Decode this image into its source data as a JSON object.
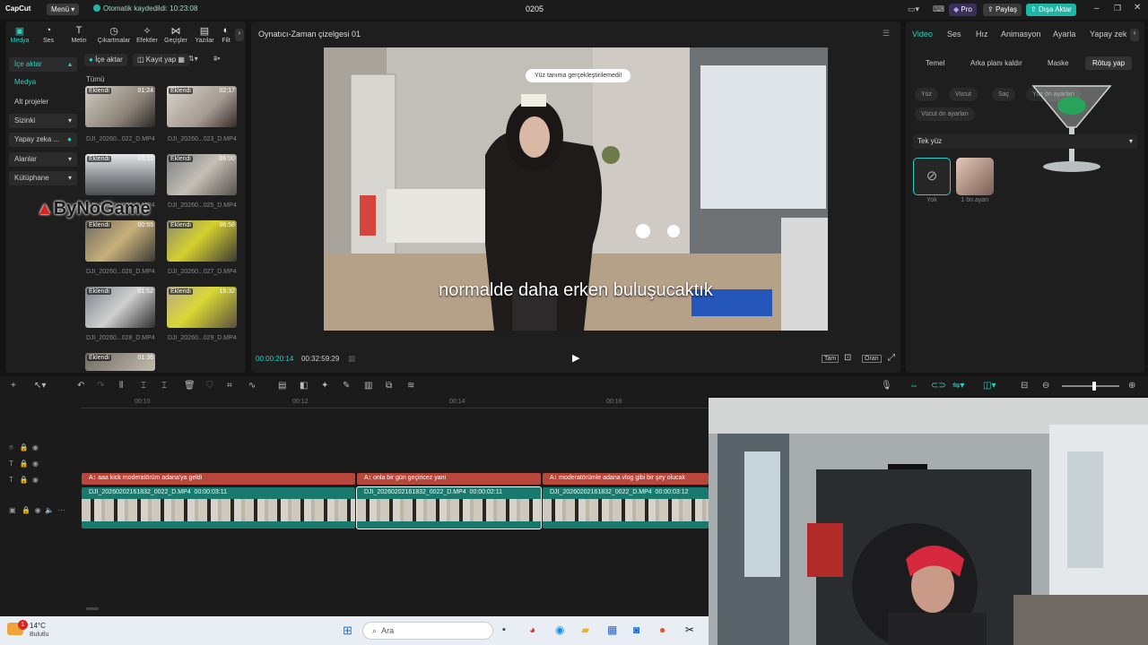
{
  "titlebar": {
    "app": "CapCut",
    "menu": "Menü",
    "autosave": "Otomatik kaydedildi: 10:23:08",
    "project": "0205",
    "pro": "Pro",
    "share": "Paylaş",
    "export": "Dışa Aktar"
  },
  "toolbar": {
    "items": [
      "Medya",
      "Ses",
      "Metin",
      "Çıkartmalar",
      "Efektler",
      "Geçişler",
      "Yazılar",
      "Filt"
    ]
  },
  "sidenav": {
    "items": [
      "İçe aktar",
      "Medya",
      "Alt projeler",
      "Sizinki",
      "Yapay zeka ...",
      "Alanlar",
      "Kütüphane"
    ]
  },
  "media": {
    "import_btn": "İçe aktar",
    "record_btn": "Kayıt yap",
    "all_label": "Tümü",
    "items": [
      {
        "badge": "Eklendi",
        "dur": "01:24",
        "name": "DJI_20260...022_D.MP4"
      },
      {
        "badge": "Eklendi",
        "dur": "02:17",
        "name": "DJI_20260...023_D.MP4"
      },
      {
        "badge": "Eklendi",
        "dur": "01:11",
        "name": "DJI_20260...024_D.MP4"
      },
      {
        "badge": "Eklendi",
        "dur": "06:00",
        "name": "DJI_20260...025_D.MP4"
      },
      {
        "badge": "Eklendi",
        "dur": "00:55",
        "name": "DJI_20260...026_D.MP4"
      },
      {
        "badge": "Eklendi",
        "dur": "06:58",
        "name": "DJI_20260...027_D.MP4"
      },
      {
        "badge": "Eklendi",
        "dur": "01:52",
        "name": "DJI_20260...028_D.MP4"
      },
      {
        "badge": "Eklendi",
        "dur": "15:32",
        "name": "DJI_20260...029_D.MP4"
      },
      {
        "badge": "Eklendi",
        "dur": "01:36",
        "name": ""
      }
    ]
  },
  "watermark": "ByNoGame",
  "player": {
    "title": "Oynatıcı-Zaman çizelgesi 01",
    "toast": "Yüz tanıma gerçekleştirilemedi!",
    "subtitle": "normalde daha erken buluşucaktık",
    "current_time": "00:00:20:14",
    "total_time": "00:32:59:29",
    "btn_full": "Tam",
    "btn_ratio": "Oran"
  },
  "inspector": {
    "tabs": [
      "Video",
      "Ses",
      "Hız",
      "Animasyon",
      "Ayarla",
      "Yapay zek"
    ],
    "subtabs": [
      "Temel",
      "Arka planı kaldır",
      "Maske",
      "Rötuş yap"
    ],
    "chips": [
      "Yüz",
      "Vücut",
      "Saç",
      "Yüz ön ayarları",
      "Vücut ön ayarları"
    ],
    "face_select": "Tek yüz",
    "presets": [
      {
        "label": "Yok"
      },
      {
        "label": "1 ön ayarı"
      }
    ]
  },
  "timeline": {
    "ruler": [
      "00:10",
      "00:12",
      "00:14",
      "00:16"
    ],
    "captions": [
      "aaa kick moderatörüm adana'ya geldi",
      "onla bir gün geçiricez yani",
      "moderatörümle adana vlog gibi bir şey olucak"
    ],
    "clips": [
      {
        "name": "DJI_20260202161832_0022_D.MP4",
        "dur": "00:00:03:11"
      },
      {
        "name": "DJI_20260202161832_0022_D.MP4",
        "dur": "00:00:02:11"
      },
      {
        "name": "DJI_20260202161832_0022_D.MP4",
        "dur": "00:00:03:12"
      }
    ]
  },
  "taskbar": {
    "weather_temp": "14°C",
    "weather_desc": "Bulutlu",
    "search": "Ara",
    "notif_count": "1"
  },
  "colors": {
    "accent": "#2ad1c0",
    "caption_track": "#b8463b",
    "video_track": "#187a6e",
    "export": "#1fb5a6"
  }
}
